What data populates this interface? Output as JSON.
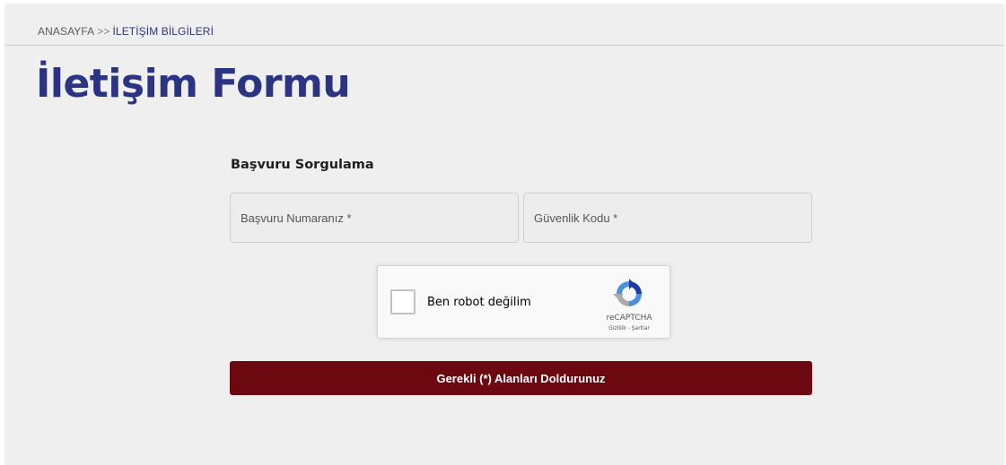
{
  "breadcrumb": {
    "home": "ANASAYFA",
    "separator": ">>",
    "current": "İLETİŞİM BİLGİLERİ"
  },
  "page_title": "İletişim Formu",
  "form": {
    "section_title": "Başvuru Sorgulama",
    "application_number_placeholder": "Başvuru Numaranız *",
    "security_code_placeholder": "Güvenlik Kodu *",
    "submit_label": "Gerekli (*) Alanları Doldurunuz"
  },
  "captcha": {
    "label": "Ben robot değilim",
    "brand": "reCAPTCHA",
    "links": "Gizlilik - Şartlar",
    "icon": "recaptcha-logo-icon"
  },
  "colors": {
    "title": "#2b3482",
    "submit_bg": "#6b0810",
    "panel_bg": "#efefef"
  }
}
